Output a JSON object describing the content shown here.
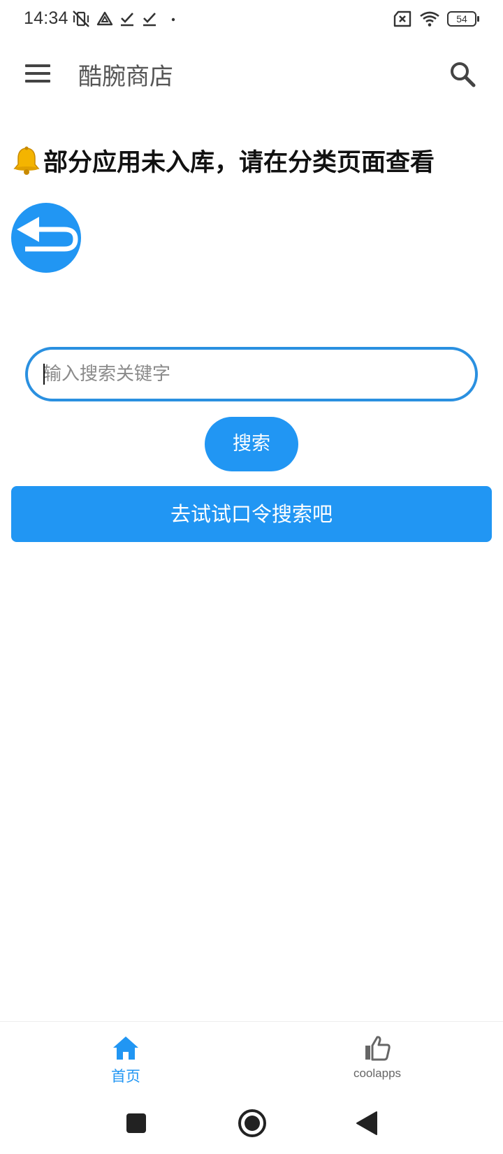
{
  "status_bar": {
    "time": "14:34",
    "battery_level": "54",
    "icons": [
      "vibrate-off-icon",
      "drive-icon",
      "check-icon",
      "check-icon",
      "dot-icon",
      "no-sim-icon",
      "wifi-icon",
      "battery-icon"
    ]
  },
  "app_bar": {
    "title": "酷腕商店",
    "menu_icon": "menu-icon",
    "search_icon": "search-icon"
  },
  "notice": {
    "icon": "bell-icon",
    "text": "部分应用未入库，请在分类页面查看"
  },
  "back_button": {
    "icon": "undo-arrow-icon"
  },
  "search": {
    "placeholder": "输入搜索关键字",
    "value": "",
    "button_label": "搜索"
  },
  "command_search": {
    "label": "去试试口令搜索吧"
  },
  "bottom_nav": {
    "items": [
      {
        "label": "首页",
        "icon": "home-icon",
        "active": true
      },
      {
        "label": "coolapps",
        "icon": "thumbs-up-icon",
        "active": false
      }
    ]
  },
  "system_nav": {
    "buttons": [
      "recents-square-icon",
      "home-circle-icon",
      "back-triangle-icon"
    ]
  },
  "colors": {
    "accent": "#2196f3",
    "text_dark": "#111111",
    "icon_gray": "#444444"
  }
}
